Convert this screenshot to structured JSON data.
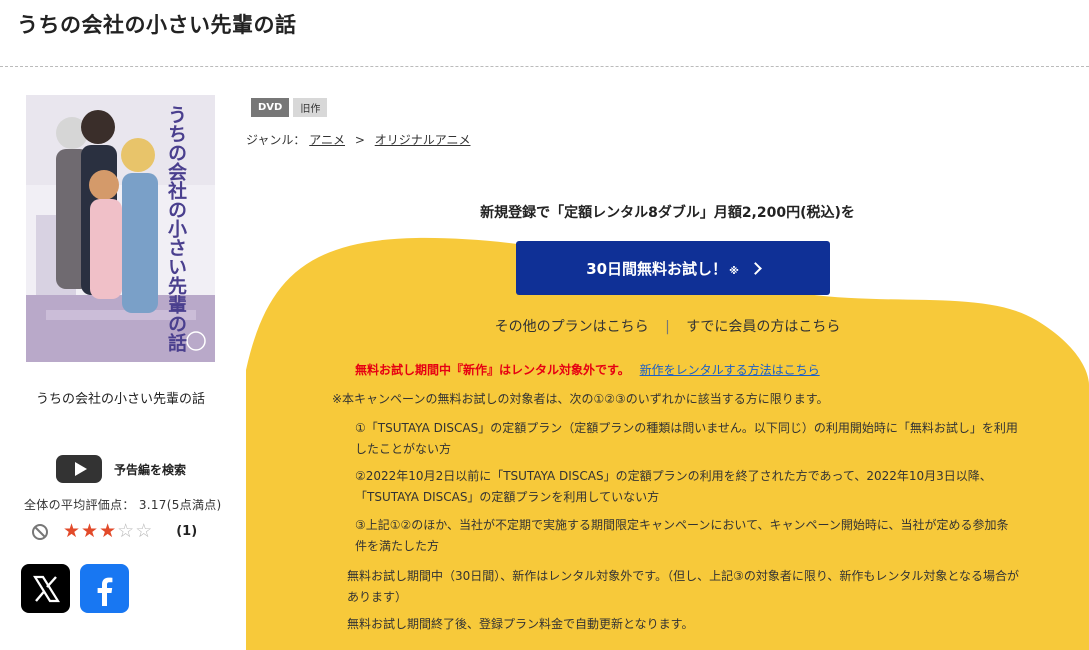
{
  "page": {
    "title": "うちの会社の小さい先輩の話"
  },
  "product": {
    "cover_title": "うちの会社の小さい先輩の話",
    "caption": "うちの会社の小さい先輩の話",
    "trailer_label": "予告編を検索",
    "rating_text": "全体の平均評価点： 3.17(5点満点)",
    "rating_value": 3.17,
    "rating_max": 5,
    "stars": [
      true,
      true,
      true,
      false,
      false
    ],
    "review_count": "(1)",
    "social": [
      "x-icon",
      "facebook-icon"
    ]
  },
  "tags": [
    "DVD",
    "旧作"
  ],
  "genre": {
    "label": "ジャンル：",
    "items": [
      "アニメ",
      "オリジナルアニメ"
    ],
    "separator": ">"
  },
  "promo": {
    "headline": "新規登録で「定額レンタル8ダブル」月額2,200円(税込)を",
    "cta_label": "30日間無料お試し！",
    "cta_note": "※",
    "other_plans": "その他のプランはこちら",
    "members": "すでに会員の方はこちら",
    "separator": "|",
    "warning": "無料お試し期間中『新作』はレンタル対象外です。",
    "warning_link": "新作をレンタルする方法はこちら",
    "note_intro": "※本キャンペーンの無料お試しの対象者は、次の①②③のいずれかに該当する方に限ります。",
    "condition_1": "①「TSUTAYA DISCAS」の定額プラン（定額プランの種類は問いません。以下同じ）の利用開始時に「無料お試し」を利用したことがない方",
    "condition_2": "②2022年10月2日以前に「TSUTAYA DISCAS」の定額プランの利用を終了された方であって、2022年10月3日以降、「TSUTAYA DISCAS」の定額プランを利用していない方",
    "condition_3": "③上記①②のほか、当社が不定期で実施する期間限定キャンペーンにおいて、キャンペーン開始時に、当社が定める参加条件を満たした方",
    "note_trial": "無料お試し期間中（30日間）、新作はレンタル対象外です。（但し、上記③の対象者に限り、新作もレンタル対象となる場合があります）",
    "note_renewal": "無料お試し期間終了後、登録プラン料金で自動更新となります。"
  },
  "colors": {
    "accent_yellow": "#f7c93a",
    "cta_blue": "#0f3096",
    "warning_red": "#e60012",
    "link_blue": "#1a5fc8",
    "star_on": "#e24a2a"
  }
}
